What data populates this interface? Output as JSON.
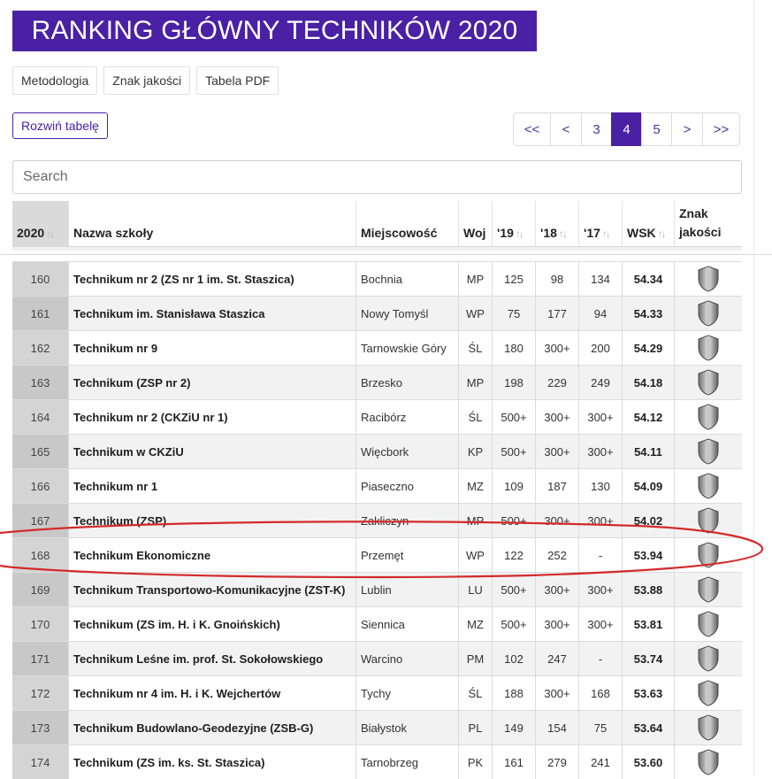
{
  "title": "RANKING GŁÓWNY TECHNIKÓW 2020",
  "links": [
    "Metodologia",
    "Znak jakości",
    "Tabela PDF"
  ],
  "expand_label": "Rozwiń tabelę",
  "pagination": {
    "items": [
      {
        "label": "<<",
        "w": 43
      },
      {
        "label": "<",
        "w": 36
      },
      {
        "label": "3",
        "w": 35
      },
      {
        "label": "4",
        "w": 35,
        "active": true
      },
      {
        "label": "5",
        "w": 35
      },
      {
        "label": ">",
        "w": 36
      },
      {
        "label": ">>",
        "w": 43
      }
    ]
  },
  "search": {
    "placeholder": "Search"
  },
  "columns": [
    {
      "label": "2020",
      "sort": true
    },
    {
      "label": "Nazwa szkoły",
      "sort": false
    },
    {
      "label": "Miejscowość",
      "sort": false
    },
    {
      "label": "Woj",
      "sort": false
    },
    {
      "label": "'19",
      "sort": true
    },
    {
      "label": "'18",
      "sort": true
    },
    {
      "label": "'17",
      "sort": true
    },
    {
      "label": "WSK",
      "sort": true
    },
    {
      "label": "Znak jakości",
      "sort": false
    }
  ],
  "rows": [
    {
      "rank": "160",
      "name": "Technikum nr 2 (ZS nr 1 im. St. Staszica)",
      "city": "Bochnia",
      "voiv": "MP",
      "y19": "125",
      "y18": "98",
      "y17": "134",
      "wsk": "54.34"
    },
    {
      "rank": "161",
      "name": "Technikum im. Stanisława Staszica",
      "city": "Nowy Tomyśl",
      "voiv": "WP",
      "y19": "75",
      "y18": "177",
      "y17": "94",
      "wsk": "54.33"
    },
    {
      "rank": "162",
      "name": "Technikum nr 9",
      "city": "Tarnowskie Góry",
      "voiv": "ŚL",
      "y19": "180",
      "y18": "300+",
      "y17": "200",
      "wsk": "54.29"
    },
    {
      "rank": "163",
      "name": "Technikum (ZSP nr 2)",
      "city": "Brzesko",
      "voiv": "MP",
      "y19": "198",
      "y18": "229",
      "y17": "249",
      "wsk": "54.18"
    },
    {
      "rank": "164",
      "name": "Technikum nr 2 (CKZiU nr 1)",
      "city": "Racibórz",
      "voiv": "ŚL",
      "y19": "500+",
      "y18": "300+",
      "y17": "300+",
      "wsk": "54.12"
    },
    {
      "rank": "165",
      "name": "Technikum w CKZiU",
      "city": "Więcbork",
      "voiv": "KP",
      "y19": "500+",
      "y18": "300+",
      "y17": "300+",
      "wsk": "54.11"
    },
    {
      "rank": "166",
      "name": "Technikum nr 1",
      "city": "Piaseczno",
      "voiv": "MZ",
      "y19": "109",
      "y18": "187",
      "y17": "130",
      "wsk": "54.09"
    },
    {
      "rank": "167",
      "name": "Technikum (ZSP)",
      "city": "Zakliczyn",
      "voiv": "MP",
      "y19": "500+",
      "y18": "300+",
      "y17": "300+",
      "wsk": "54.02"
    },
    {
      "rank": "168",
      "name": "Technikum Ekonomiczne",
      "city": "Przemęt",
      "voiv": "WP",
      "y19": "122",
      "y18": "252",
      "y17": "-",
      "wsk": "53.94"
    },
    {
      "rank": "169",
      "name": "Technikum Transportowo-Komunikacyjne (ZST-K)",
      "city": "Lublin",
      "voiv": "LU",
      "y19": "500+",
      "y18": "300+",
      "y17": "300+",
      "wsk": "53.88"
    },
    {
      "rank": "170",
      "name": "Technikum (ZS im. H. i K. Gnoińskich)",
      "city": "Siennica",
      "voiv": "MZ",
      "y19": "500+",
      "y18": "300+",
      "y17": "300+",
      "wsk": "53.81"
    },
    {
      "rank": "171",
      "name": "Technikum Leśne im. prof. St. Sokołowskiego",
      "city": "Warcino",
      "voiv": "PM",
      "y19": "102",
      "y18": "247",
      "y17": "-",
      "wsk": "53.74"
    },
    {
      "rank": "172",
      "name": "Technikum nr 4 im. H. i K. Wejchertów",
      "city": "Tychy",
      "voiv": "ŚL",
      "y19": "188",
      "y18": "300+",
      "y17": "168",
      "wsk": "53.63"
    },
    {
      "rank": "173",
      "name": "Technikum Budowlano-Geodezyjne (ZSB-G)",
      "city": "Białystok",
      "voiv": "PL",
      "y19": "149",
      "y18": "154",
      "y17": "75",
      "wsk": "53.64"
    },
    {
      "rank": "174",
      "name": "Technikum (ZS im. ks. St. Staszica)",
      "city": "Tarnobrzeg",
      "voiv": "PK",
      "y19": "161",
      "y18": "279",
      "y17": "241",
      "wsk": "53.60"
    }
  ],
  "colors": {
    "brand": "#4a20a5",
    "annotation": "#d42a2a",
    "shield": "#8a8a8a"
  },
  "icons": {
    "quality_badge": "shield-icon",
    "sort": "sort-arrows-icon"
  }
}
